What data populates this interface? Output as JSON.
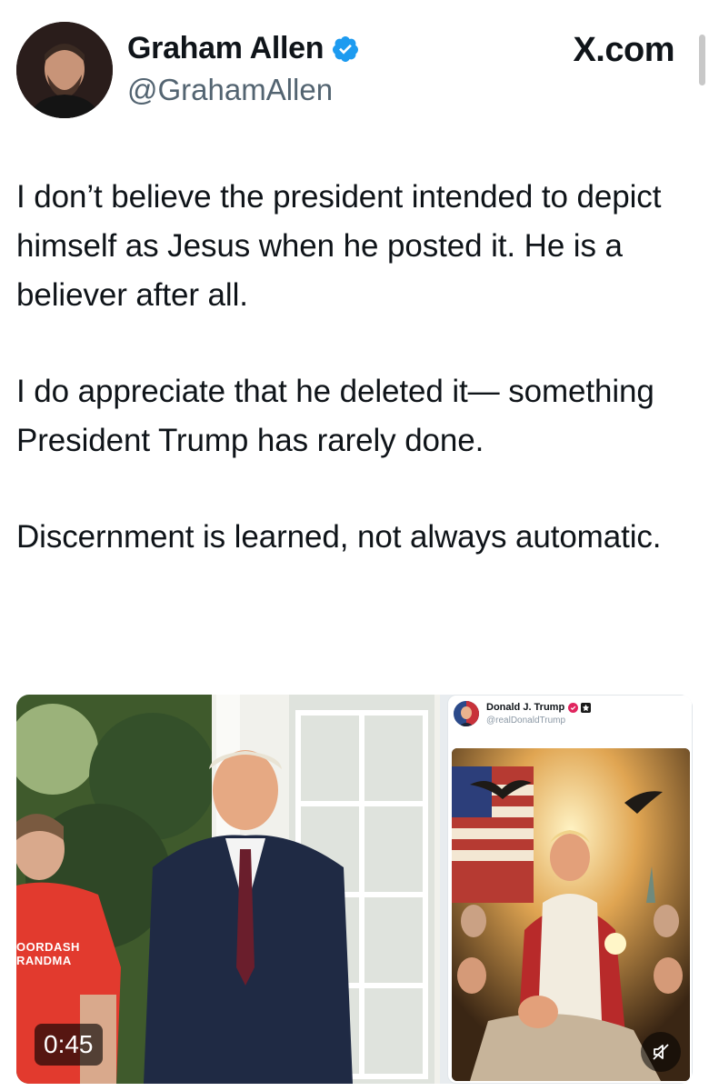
{
  "header": {
    "display_name": "Graham Allen",
    "handle": "@GrahamAllen",
    "brand": "X.com",
    "verified_color": "#1d9bf0"
  },
  "tweet": {
    "paragraphs": [
      "I don’t believe the president intended to depict himself as Jesus when he posted it. He is a believer after all.",
      "I do appreciate that he deleted it— something President Trump has rarely done.",
      "Discernment is learned, not always automatic."
    ]
  },
  "media": {
    "video": {
      "duration": "0:45",
      "shirt_text_line1": "OORDASH",
      "shirt_text_line2": "RANDMA"
    },
    "embedded_post": {
      "display_name": "Donald J. Trump",
      "handle": "@realDonaldTrump",
      "badge_color": "#e0245e"
    }
  },
  "icons": [
    "verified-badge-icon",
    "mute-icon"
  ]
}
